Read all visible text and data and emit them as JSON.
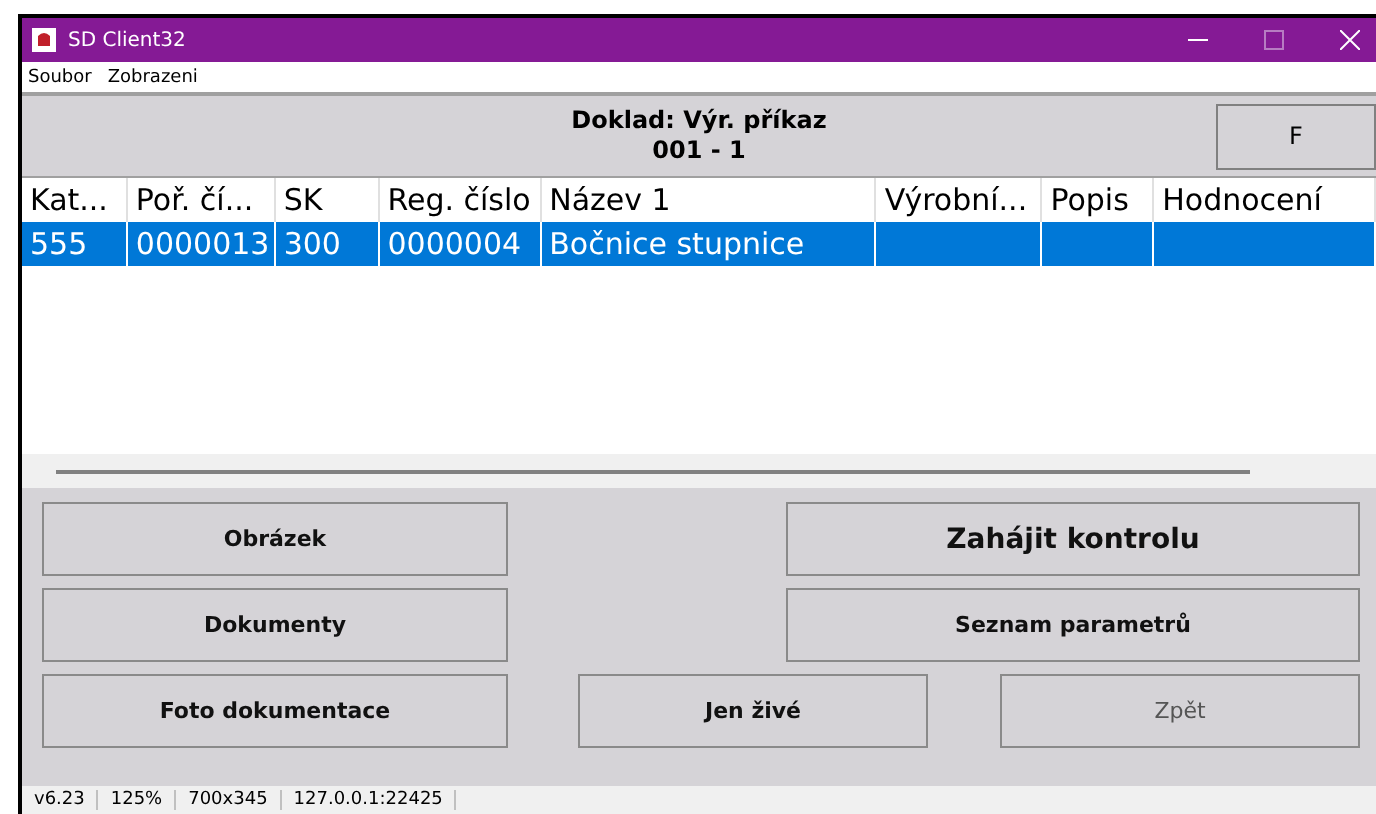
{
  "window": {
    "title": "SD Client32"
  },
  "menu": [
    "Soubor",
    "Zobrazeni"
  ],
  "header": {
    "title": "Doklad: Výr. příkaz",
    "subtitle": "001 - 1",
    "button": "F"
  },
  "table": {
    "columns": [
      "Kat...",
      "Poř. čí...",
      "SK",
      "Reg. číslo",
      "Název 1",
      "Výrobní...",
      "Popis",
      "Hodnocení"
    ],
    "rows": [
      {
        "cells": [
          "555",
          "0000013",
          "300",
          "0000004",
          "Bočnice stupnice",
          "",
          "",
          ""
        ],
        "selected": true
      }
    ]
  },
  "buttons": [
    {
      "label": "Obrázek",
      "disabled": false
    },
    {
      "label": "Zahájit kontrolu",
      "disabled": false
    },
    {
      "label": "Dokumenty",
      "disabled": false
    },
    {
      "label": "Seznam parametrů",
      "disabled": false
    },
    {
      "label": "Foto dokumentace",
      "disabled": false
    },
    {
      "label": "Jen živé",
      "disabled": false
    },
    {
      "label": "Zpět",
      "disabled": true
    }
  ],
  "status_bar": [
    "v6.23",
    "125%",
    "700x345",
    "127.0.0.1:22425"
  ]
}
